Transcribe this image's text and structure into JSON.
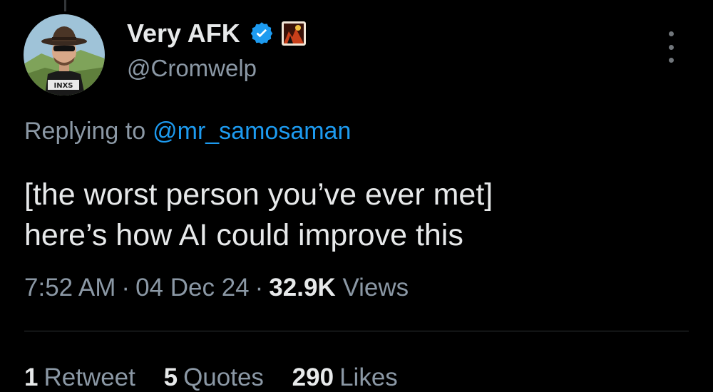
{
  "tweet": {
    "author": {
      "display_name": "Very AFK",
      "handle": "@Cromwelp",
      "avatar_icon": "user-avatar-photo",
      "verified_icon": "verified-badge-icon",
      "affiliate_icon": "affiliate-badge-icon",
      "verified_color": "#1d9bf0"
    },
    "reply_context": {
      "prefix": "Replying to",
      "mention": "@mr_samosaman"
    },
    "text_lines": [
      "[the worst person you’ve ever met]",
      "here’s how AI could improve this"
    ],
    "meta": {
      "time": "7:52 AM",
      "date": "04 Dec 24",
      "views_count": "32.9K",
      "views_label": "Views",
      "separator": "·"
    },
    "stats": {
      "retweets_count": "1",
      "retweets_label": "Retweet",
      "quotes_count": "5",
      "quotes_label": "Quotes",
      "likes_count": "290",
      "likes_label": "Likes"
    },
    "colors": {
      "background": "#000000",
      "primary_text": "#e7e9ea",
      "secondary_text": "#8b98a5",
      "link": "#1d9bf0",
      "divider": "#2f3336"
    }
  }
}
